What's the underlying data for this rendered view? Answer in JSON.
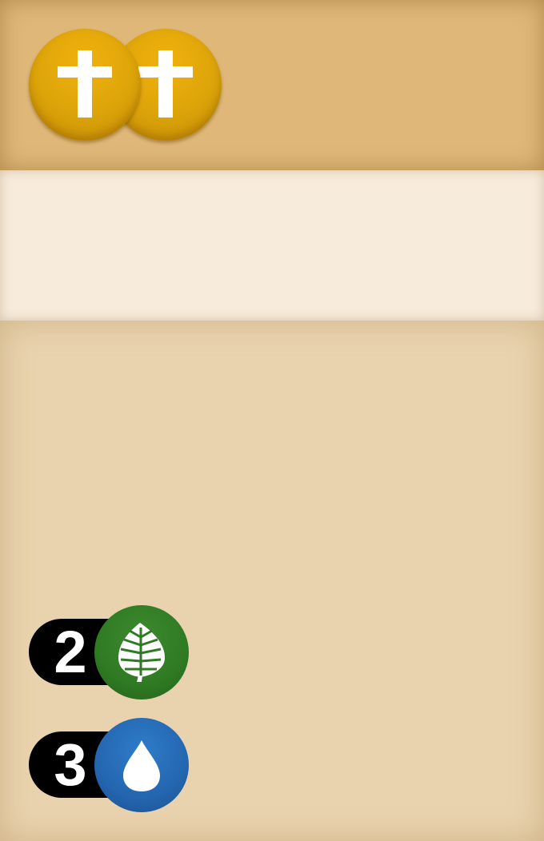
{
  "card": {
    "header": {
      "coins": [
        {
          "icon": "cross-icon",
          "color": "#dca409"
        },
        {
          "icon": "cross-icon",
          "color": "#dca409"
        }
      ]
    },
    "band": {
      "text": ""
    },
    "costs": [
      {
        "amount": "2",
        "icon": "leaf-icon",
        "color": "#2f7a23"
      },
      {
        "amount": "3",
        "icon": "water-drop-icon",
        "color": "#2466b0"
      }
    ]
  }
}
